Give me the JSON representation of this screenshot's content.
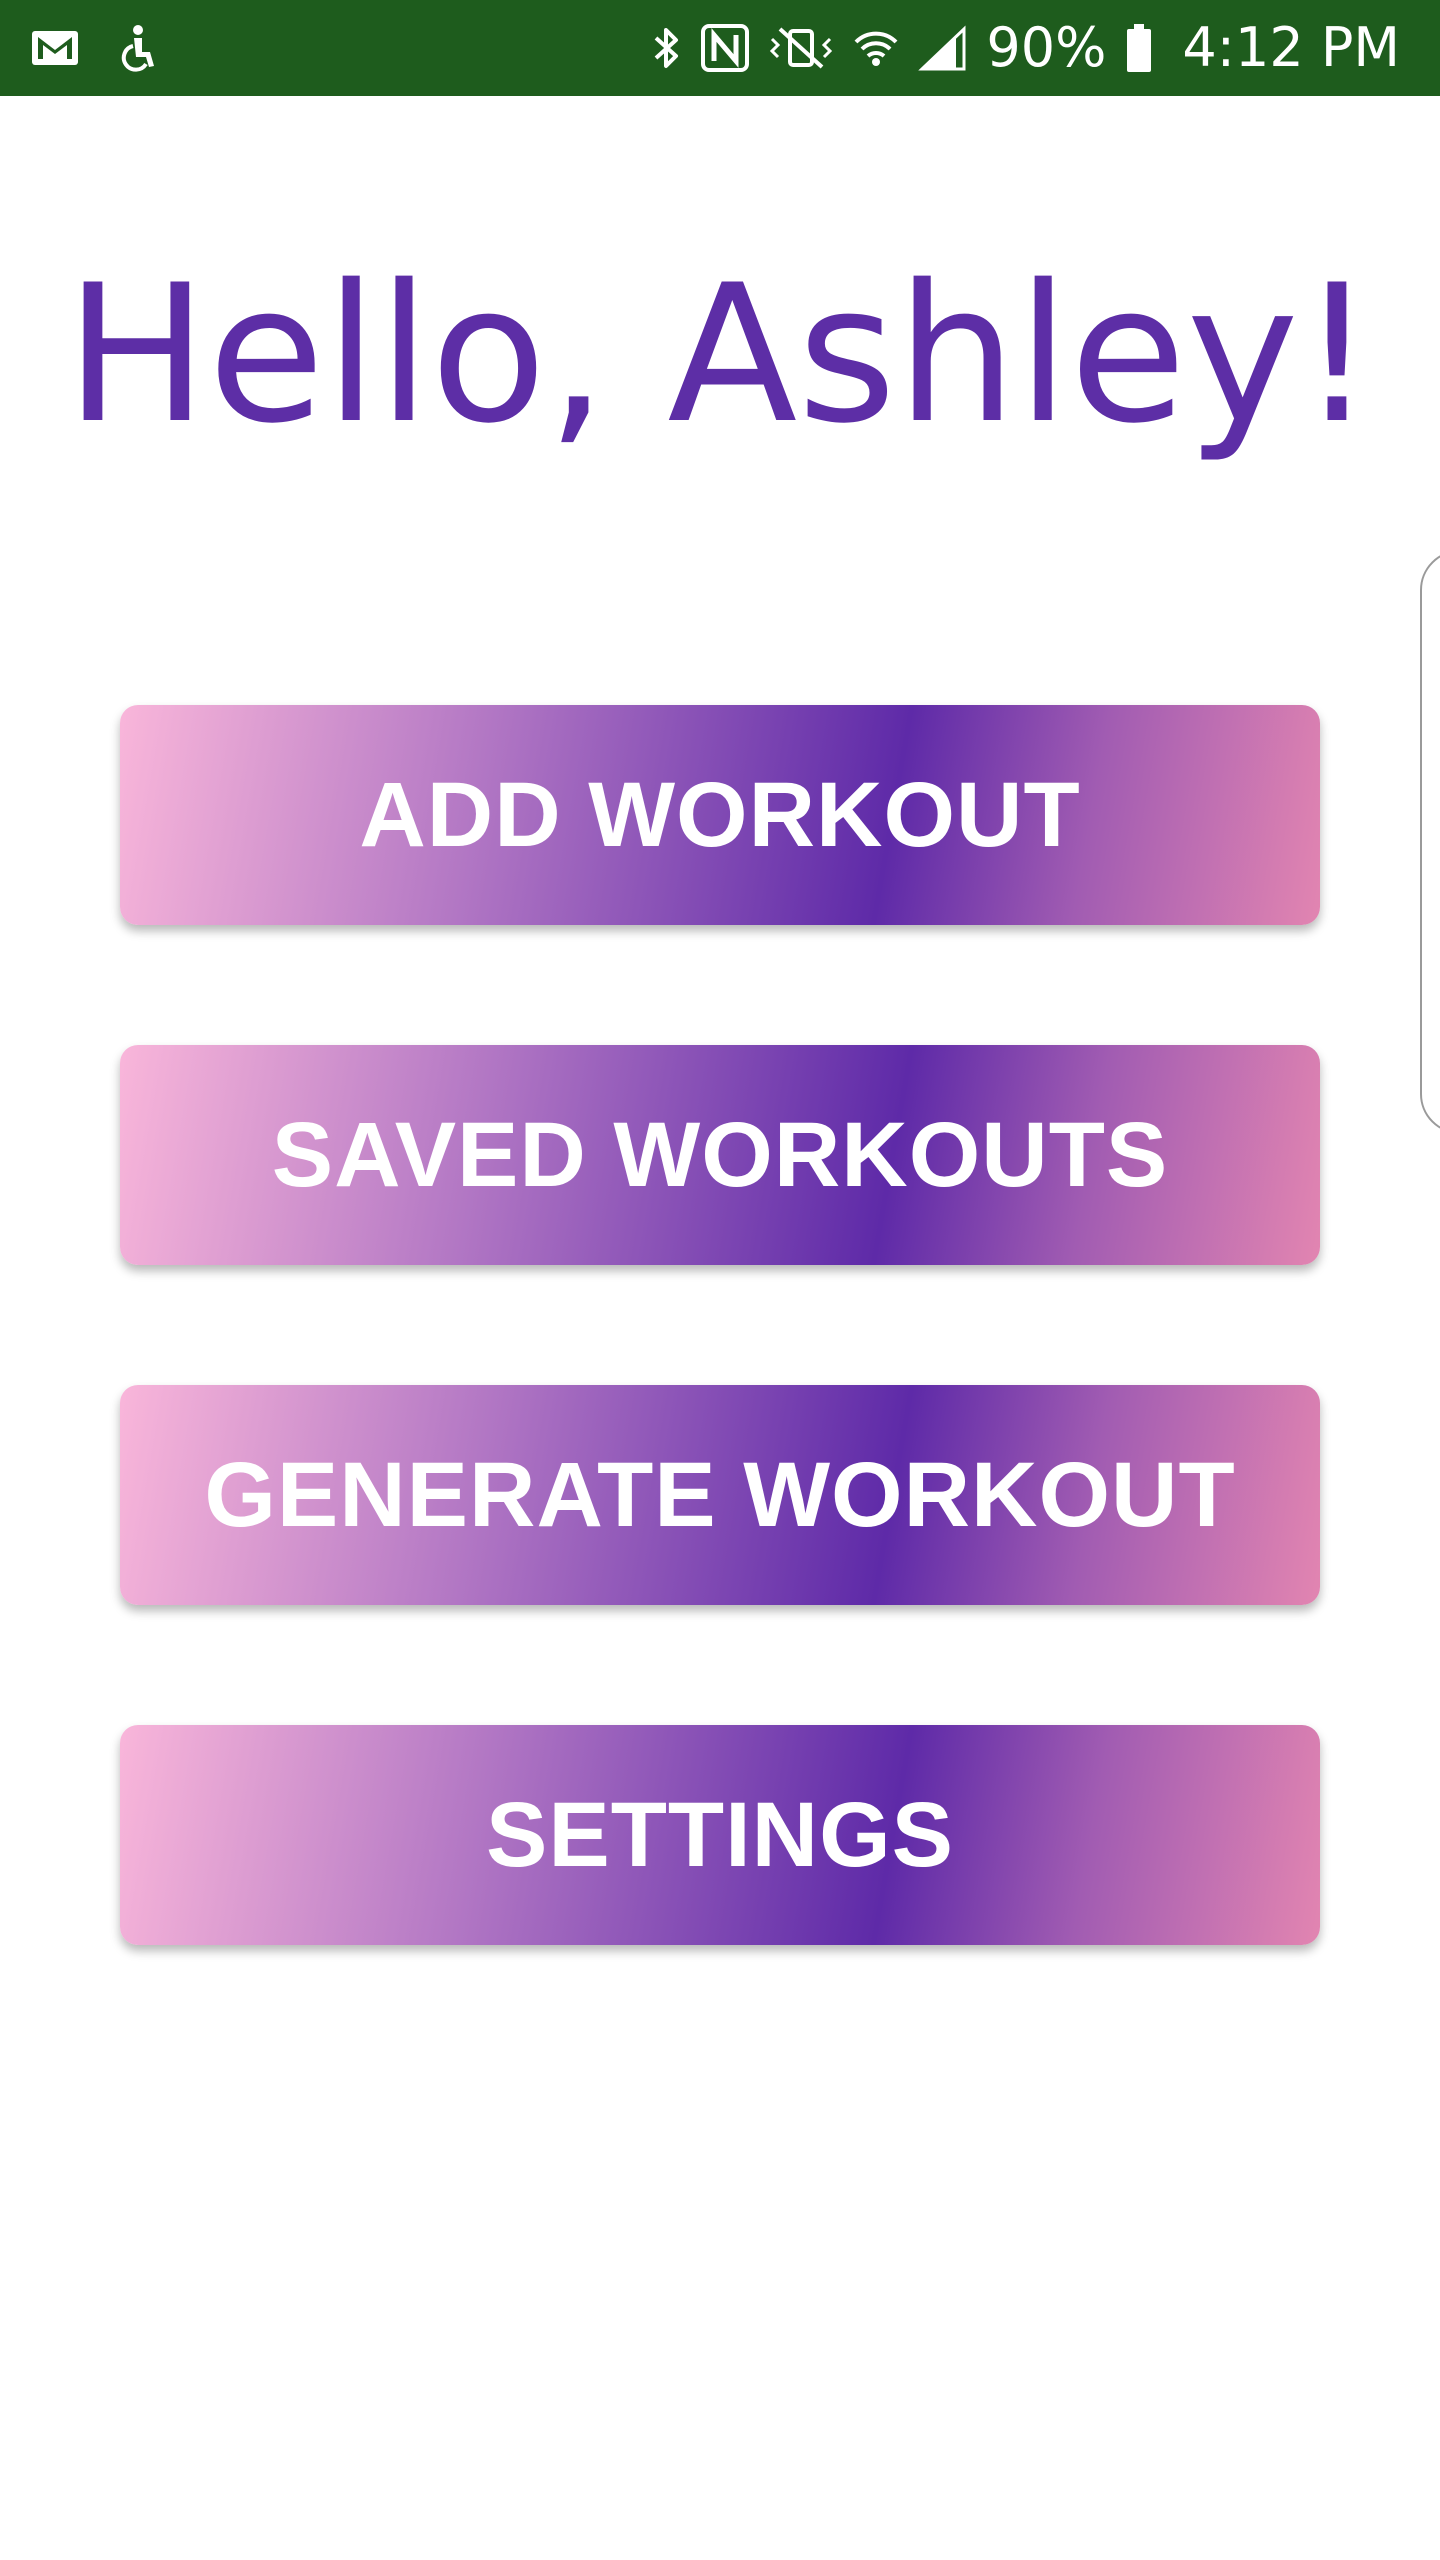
{
  "status_bar": {
    "battery_percent": "90%",
    "time": "4:12 PM",
    "icons": [
      "gmail-icon",
      "accessibility-icon",
      "bluetooth-icon",
      "nfc-icon",
      "vibrate-mute-icon",
      "wifi-icon",
      "signal-icon",
      "battery-icon"
    ],
    "background_color": "#1e5c1d"
  },
  "main": {
    "greeting": "Hello, Ashley!",
    "greeting_color": "#5d2ea6",
    "buttons": [
      {
        "label": "ADD WORKOUT"
      },
      {
        "label": "SAVED WORKOUTS"
      },
      {
        "label": "GENERATE WORKOUT"
      },
      {
        "label": "SETTINGS"
      }
    ],
    "button_gradient_colors": [
      "#f9b6da",
      "#b277c4",
      "#5e2aa8",
      "#a15cb2",
      "#e285b1"
    ]
  }
}
